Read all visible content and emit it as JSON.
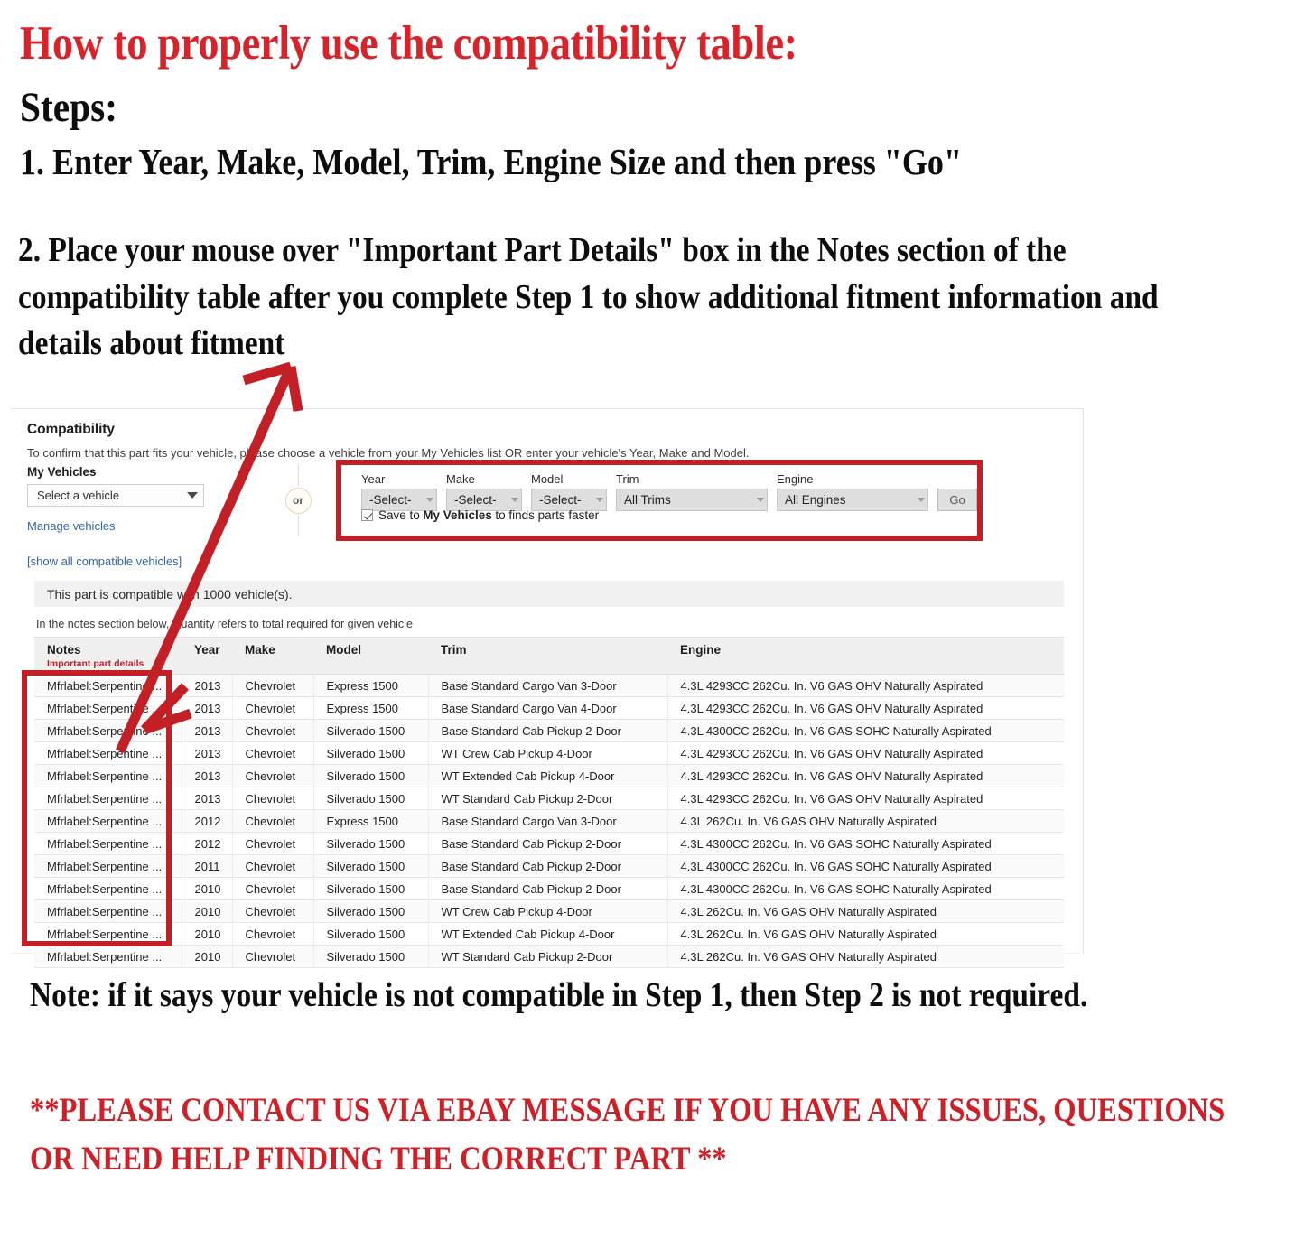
{
  "headings": {
    "title": "How to properly use the compatibility table:",
    "steps_label": "Steps:",
    "step_one": "1. Enter Year, Make, Model, Trim, Engine Size and then press \"Go\"",
    "step_two": "2. Place your mouse over \"Important Part Details\" box in the Notes section of the compatibility table after you complete Step 1 to show additional fitment information and details about fitment",
    "bottom_note": "Note: if it says your vehicle is not compatible in Step 1, then Step 2 is not required.",
    "contact_note": "**PLEASE CONTACT US VIA EBAY MESSAGE IF YOU HAVE ANY ISSUES, QUESTIONS OR NEED HELP FINDING THE CORRECT PART **"
  },
  "colors": {
    "heading_red": "#d8232a",
    "contact_red": "#cf2027",
    "annotation_red": "#c22026",
    "link_blue": "#3665a5",
    "important_details_red": "#c02026"
  },
  "compatibility": {
    "heading": "Compatibility",
    "subtitle": "To confirm that this part fits your vehicle, please choose a vehicle from your My Vehicles list OR enter your vehicle's Year, Make and Model.",
    "my_vehicles_label": "My Vehicles",
    "vehicle_select_value": "Select a vehicle",
    "manage_vehicles_link": "Manage vehicles",
    "show_all_link": "[show all compatible vehicles]",
    "or_badge": "or",
    "banner": "This part is compatible with 1000 vehicle(s).",
    "quantity_note": "In the notes section below, Quantity refers to total required for given vehicle"
  },
  "finder": {
    "fields": [
      {
        "label": "Year",
        "value": "-Select-"
      },
      {
        "label": "Make",
        "value": "-Select-"
      },
      {
        "label": "Model",
        "value": "-Select-"
      },
      {
        "label": "Trim",
        "value": "All Trims"
      },
      {
        "label": "Engine",
        "value": "All Engines"
      }
    ],
    "go_label": "Go",
    "save_prefix": "Save to",
    "save_bold": "My Vehicles",
    "save_suffix": "to finds parts faster",
    "save_checked": true
  },
  "table": {
    "columns": [
      {
        "key": "notes",
        "label": "Notes",
        "sublabel": "Important part details"
      },
      {
        "key": "year",
        "label": "Year",
        "sublabel": ""
      },
      {
        "key": "make",
        "label": "Make",
        "sublabel": ""
      },
      {
        "key": "model",
        "label": "Model",
        "sublabel": ""
      },
      {
        "key": "trim",
        "label": "Trim",
        "sublabel": ""
      },
      {
        "key": "engine",
        "label": "Engine",
        "sublabel": ""
      }
    ],
    "rows": [
      {
        "notes": "Mfrlabel:Serpentine ...",
        "year": "2013",
        "make": "Chevrolet",
        "model": "Express 1500",
        "trim": "Base Standard Cargo Van 3-Door",
        "engine": "4.3L 4293CC 262Cu. In. V6 GAS OHV Naturally Aspirated"
      },
      {
        "notes": "Mfrlabel:Serpentine ...",
        "year": "2013",
        "make": "Chevrolet",
        "model": "Express 1500",
        "trim": "Base Standard Cargo Van 4-Door",
        "engine": "4.3L 4293CC 262Cu. In. V6 GAS OHV Naturally Aspirated"
      },
      {
        "notes": "Mfrlabel:Serpentine ...",
        "year": "2013",
        "make": "Chevrolet",
        "model": "Silverado 1500",
        "trim": "Base Standard Cab Pickup 2-Door",
        "engine": "4.3L 4300CC 262Cu. In. V6 GAS SOHC Naturally Aspirated"
      },
      {
        "notes": "Mfrlabel:Serpentine ...",
        "year": "2013",
        "make": "Chevrolet",
        "model": "Silverado 1500",
        "trim": "WT Crew Cab Pickup 4-Door",
        "engine": "4.3L 4293CC 262Cu. In. V6 GAS OHV Naturally Aspirated"
      },
      {
        "notes": "Mfrlabel:Serpentine ...",
        "year": "2013",
        "make": "Chevrolet",
        "model": "Silverado 1500",
        "trim": "WT Extended Cab Pickup 4-Door",
        "engine": "4.3L 4293CC 262Cu. In. V6 GAS OHV Naturally Aspirated"
      },
      {
        "notes": "Mfrlabel:Serpentine ...",
        "year": "2013",
        "make": "Chevrolet",
        "model": "Silverado 1500",
        "trim": "WT Standard Cab Pickup 2-Door",
        "engine": "4.3L 4293CC 262Cu. In. V6 GAS OHV Naturally Aspirated"
      },
      {
        "notes": "Mfrlabel:Serpentine ...",
        "year": "2012",
        "make": "Chevrolet",
        "model": "Express 1500",
        "trim": "Base Standard Cargo Van 3-Door",
        "engine": "4.3L 262Cu. In. V6 GAS OHV Naturally Aspirated"
      },
      {
        "notes": "Mfrlabel:Serpentine ...",
        "year": "2012",
        "make": "Chevrolet",
        "model": "Silverado 1500",
        "trim": "Base Standard Cab Pickup 2-Door",
        "engine": "4.3L 4300CC 262Cu. In. V6 GAS SOHC Naturally Aspirated"
      },
      {
        "notes": "Mfrlabel:Serpentine ...",
        "year": "2011",
        "make": "Chevrolet",
        "model": "Silverado 1500",
        "trim": "Base Standard Cab Pickup 2-Door",
        "engine": "4.3L 4300CC 262Cu. In. V6 GAS SOHC Naturally Aspirated"
      },
      {
        "notes": "Mfrlabel:Serpentine ...",
        "year": "2010",
        "make": "Chevrolet",
        "model": "Silverado 1500",
        "trim": "Base Standard Cab Pickup 2-Door",
        "engine": "4.3L 4300CC 262Cu. In. V6 GAS SOHC Naturally Aspirated"
      },
      {
        "notes": "Mfrlabel:Serpentine ...",
        "year": "2010",
        "make": "Chevrolet",
        "model": "Silverado 1500",
        "trim": "WT Crew Cab Pickup 4-Door",
        "engine": "4.3L 262Cu. In. V6 GAS OHV Naturally Aspirated"
      },
      {
        "notes": "Mfrlabel:Serpentine ...",
        "year": "2010",
        "make": "Chevrolet",
        "model": "Silverado 1500",
        "trim": "WT Extended Cab Pickup 4-Door",
        "engine": "4.3L 262Cu. In. V6 GAS OHV Naturally Aspirated"
      },
      {
        "notes": "Mfrlabel:Serpentine ...",
        "year": "2010",
        "make": "Chevrolet",
        "model": "Silverado 1500",
        "trim": "WT Standard Cab Pickup 2-Door",
        "engine": "4.3L 262Cu. In. V6 GAS OHV Naturally Aspirated"
      }
    ]
  }
}
